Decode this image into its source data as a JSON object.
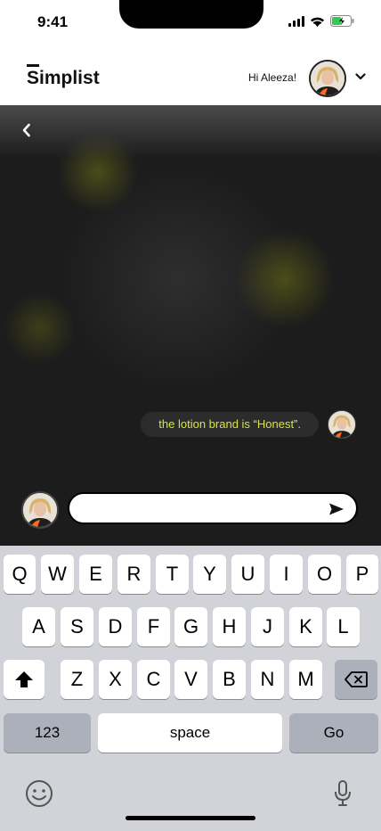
{
  "status_bar": {
    "time": "9:41"
  },
  "header": {
    "logo": "Simplist",
    "greeting": "Hi Aleeza!"
  },
  "chat": {
    "messages": [
      {
        "text": "the lotion brand is “Honest”."
      }
    ]
  },
  "composer": {
    "placeholder": ""
  },
  "keyboard": {
    "row1": [
      "Q",
      "W",
      "E",
      "R",
      "T",
      "Y",
      "U",
      "I",
      "O",
      "P"
    ],
    "row2": [
      "A",
      "S",
      "D",
      "F",
      "G",
      "H",
      "J",
      "K",
      "L"
    ],
    "row3": [
      "Z",
      "X",
      "C",
      "V",
      "B",
      "N",
      "M"
    ],
    "numbers_label": "123",
    "space_label": "space",
    "go_label": "Go"
  },
  "colors": {
    "accent": "#d8e63a",
    "chat_bg": "#1c1c1c"
  }
}
